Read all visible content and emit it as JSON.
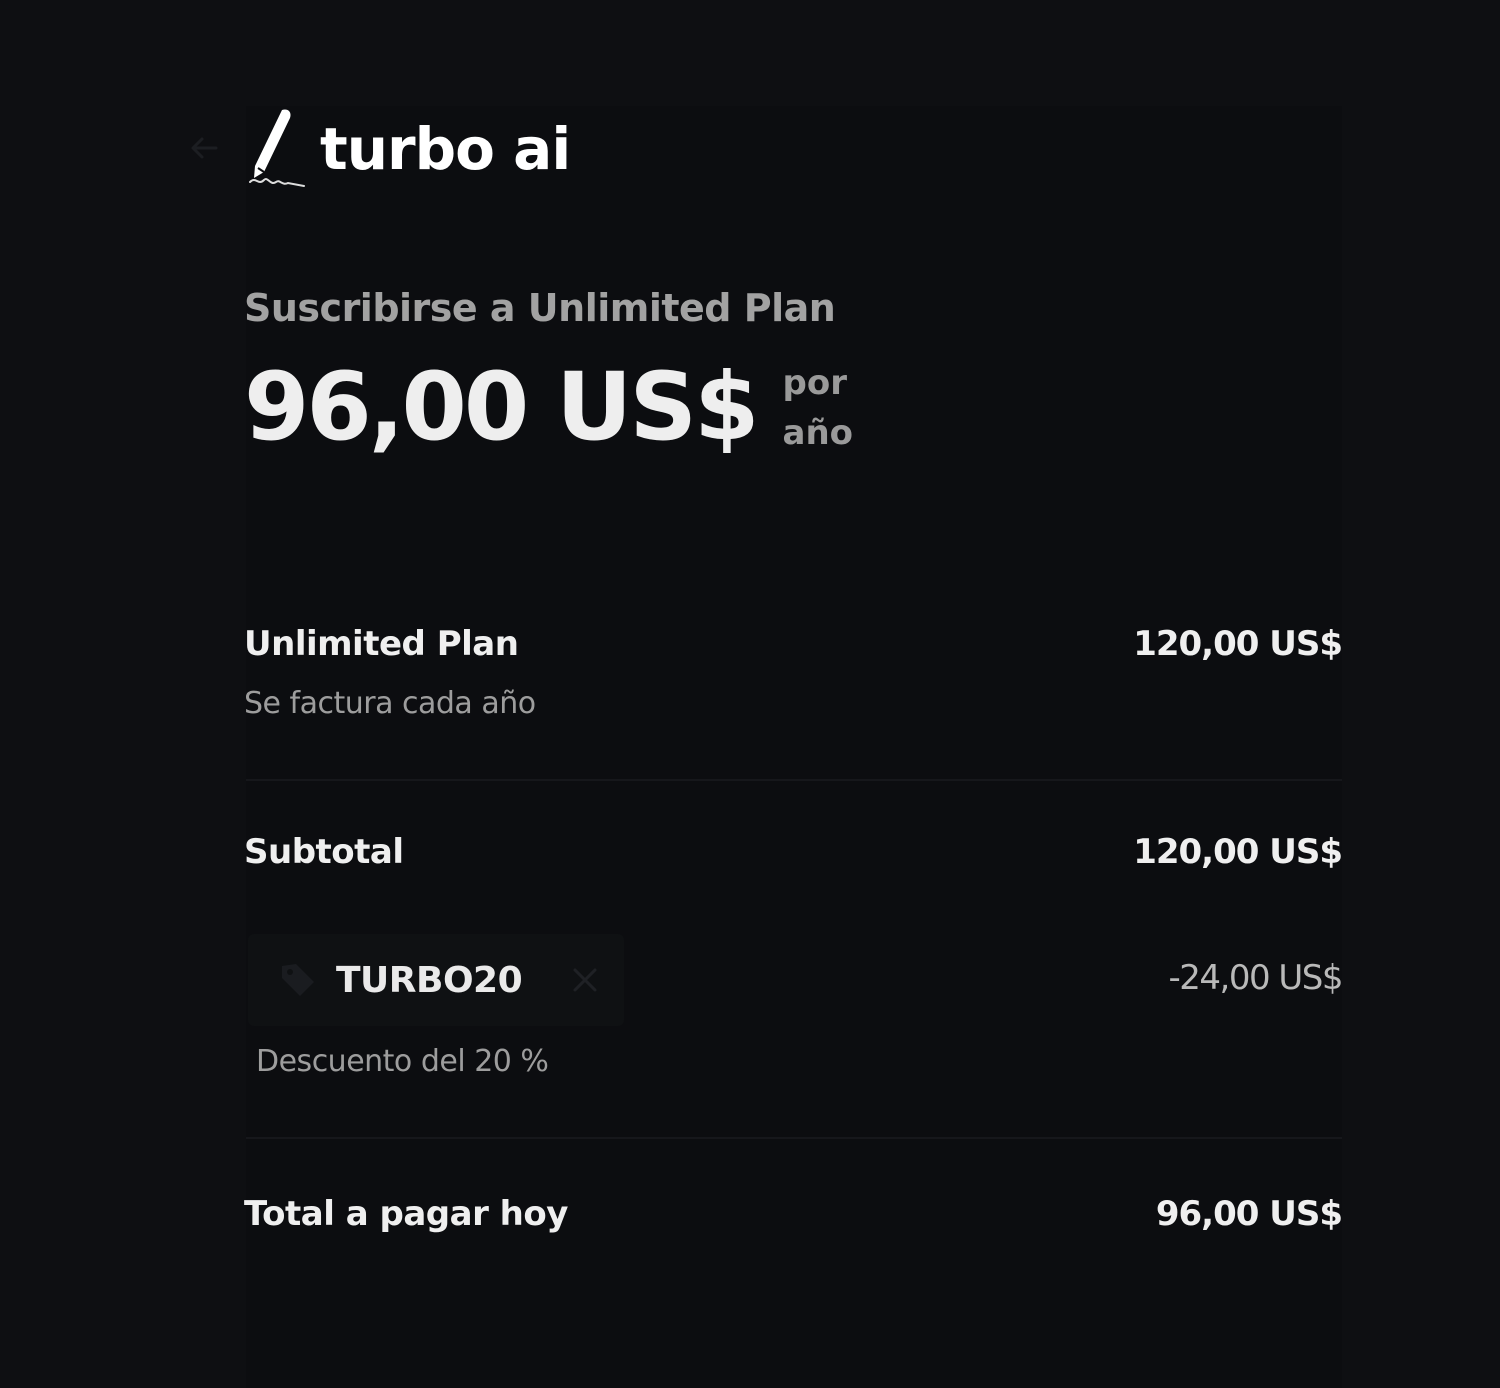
{
  "header": {
    "brand_name": "turbo ai",
    "back_icon": "arrow-left-icon",
    "logo_icon": "pen-signature-icon"
  },
  "plan": {
    "subscribe_title": "Suscribirse a Unlimited Plan",
    "price": "96,00 US$",
    "period": "por año"
  },
  "line_items": {
    "plan_name": "Unlimited Plan",
    "plan_billing": "Se factura cada año",
    "plan_amount": "120,00 US$"
  },
  "subtotal": {
    "label": "Subtotal",
    "amount": "120,00 US$"
  },
  "promo": {
    "tag_icon": "tag-icon",
    "code": "TURBO20",
    "remove_icon": "close-icon",
    "description": "Descuento del 20 %",
    "amount": "-24,00 US$"
  },
  "total": {
    "label": "Total a pagar hoy",
    "amount": "96,00 US$"
  },
  "colors": {
    "background": "#0e0f12",
    "panel": "#0c0d10",
    "text_primary": "#efefef",
    "text_muted": "#9d9d9d"
  }
}
